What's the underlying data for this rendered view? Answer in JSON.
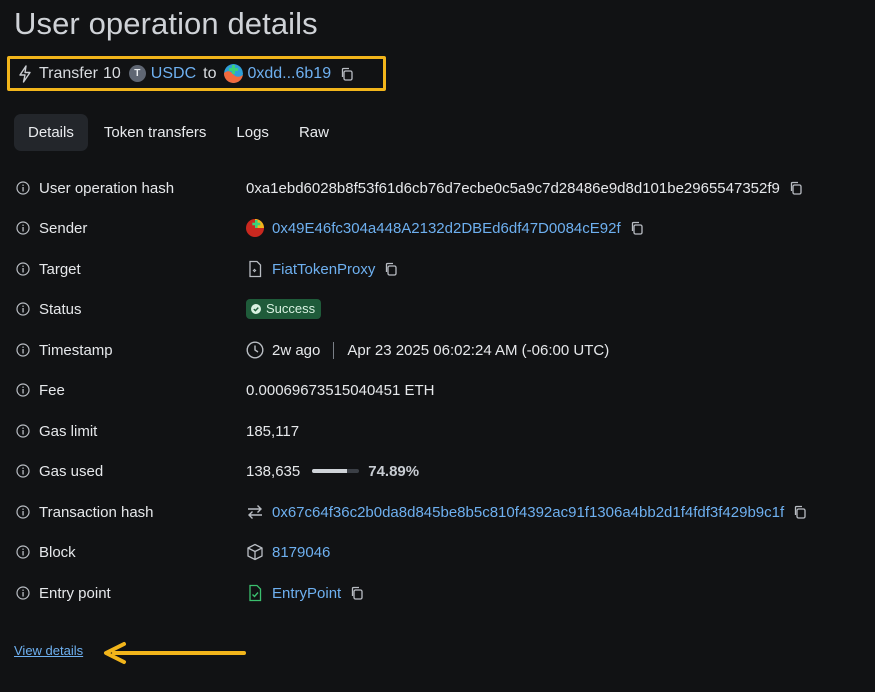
{
  "page": {
    "title": "User operation details"
  },
  "summary": {
    "action": "Transfer",
    "amount": "10",
    "token_letter": "T",
    "token": "USDC",
    "to_word": "to",
    "recipient": "0xdd...6b19"
  },
  "tabs": [
    {
      "label": "Details",
      "active": true
    },
    {
      "label": "Token transfers",
      "active": false
    },
    {
      "label": "Logs",
      "active": false
    },
    {
      "label": "Raw",
      "active": false
    }
  ],
  "details": {
    "user_op_hash": {
      "label": "User operation hash",
      "value": "0xa1ebd6028b8f53f61d6cb76d7ecbe0c5a9c7d28486e9d8d101be2965547352f9"
    },
    "sender": {
      "label": "Sender",
      "value": "0x49E46fc304a448A2132d2DBEd6df47D0084cE92f"
    },
    "target": {
      "label": "Target",
      "value": "FiatTokenProxy"
    },
    "status": {
      "label": "Status",
      "value": "Success"
    },
    "timestamp": {
      "label": "Timestamp",
      "relative": "2w ago",
      "absolute": "Apr 23 2025 06:02:24 AM (-06:00 UTC)"
    },
    "fee": {
      "label": "Fee",
      "value": "0.00069673515040451 ETH"
    },
    "gas_limit": {
      "label": "Gas limit",
      "value": "185,117"
    },
    "gas_used": {
      "label": "Gas used",
      "value": "138,635",
      "percent_label": "74.89%",
      "fraction": 0.7489
    },
    "tx_hash": {
      "label": "Transaction hash",
      "value": "0x67c64f36c2b0da8d845be8b5c810f4392ac91f1306a4bb2d1f4fdf3f429b9c1f"
    },
    "block": {
      "label": "Block",
      "value": "8179046"
    },
    "entry_point": {
      "label": "Entry point",
      "value": "EntryPoint"
    }
  },
  "footer": {
    "view_details": "View details"
  },
  "colors": {
    "accent_highlight": "#f2b51b",
    "link": "#6eb0f0",
    "success_bg": "#1f5b3a",
    "background": "#111214"
  },
  "icons": [
    "bolt-icon",
    "token-icon",
    "avatar-icon",
    "copy-icon",
    "info-icon",
    "contract-icon",
    "check-circle-icon",
    "clock-icon",
    "transfer-icon",
    "cube-icon",
    "verified-contract-icon",
    "arrow-left-icon"
  ]
}
